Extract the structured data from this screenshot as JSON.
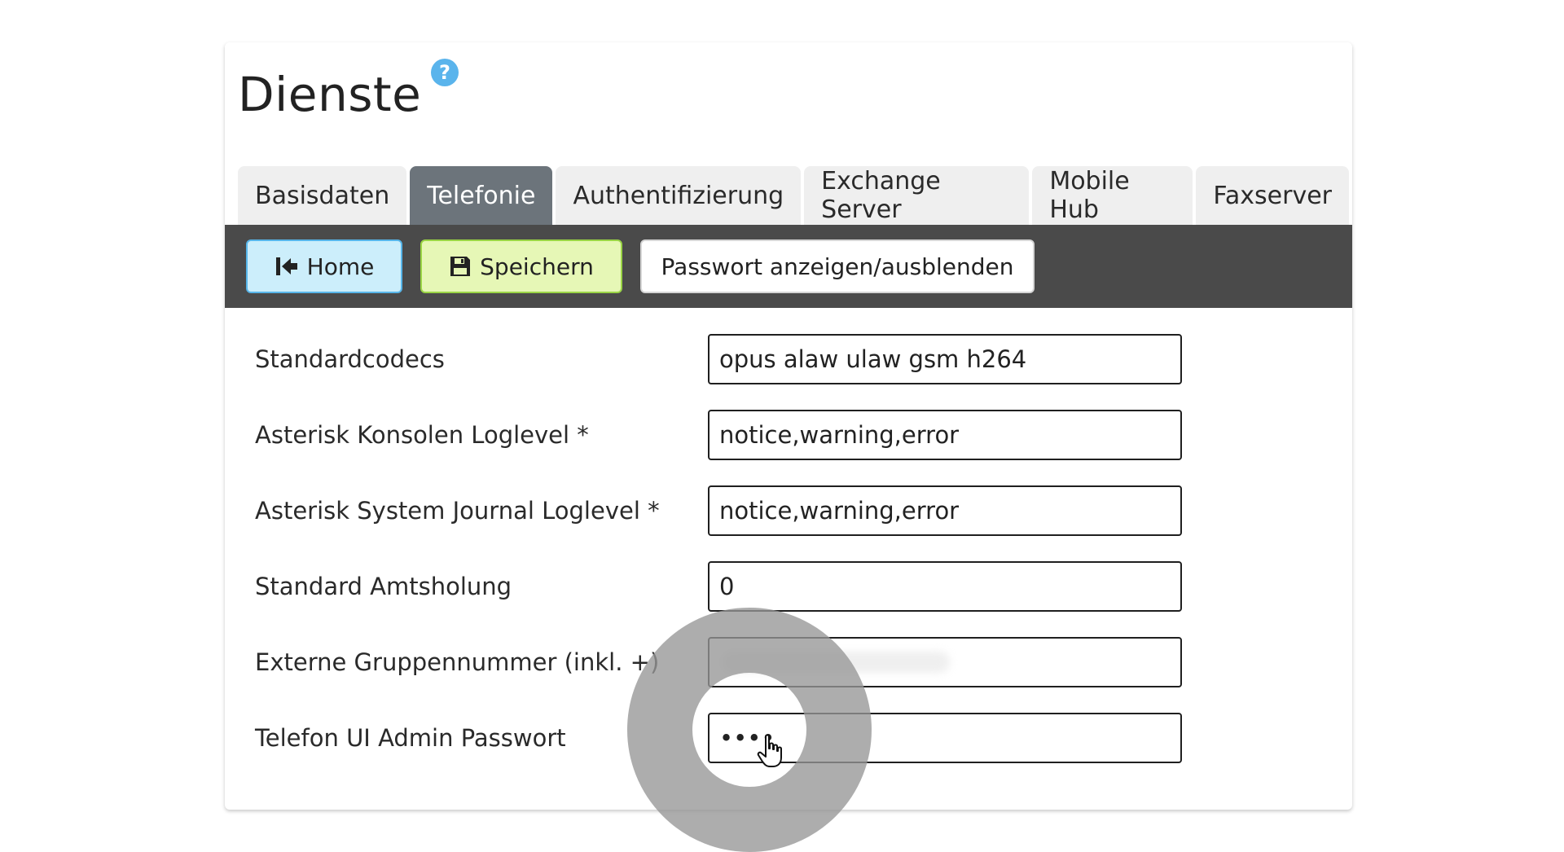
{
  "page": {
    "title": "Dienste",
    "help_icon": "question-circle-icon"
  },
  "tabs": [
    {
      "label": "Basisdaten",
      "active": false
    },
    {
      "label": "Telefonie",
      "active": true
    },
    {
      "label": "Authentifizierung",
      "active": false
    },
    {
      "label": "Exchange Server",
      "active": false
    },
    {
      "label": "Mobile Hub",
      "active": false
    },
    {
      "label": "Faxserver",
      "active": false
    }
  ],
  "toolbar": {
    "home_label": "Home",
    "home_icon": "first-page-icon",
    "save_label": "Speichern",
    "save_icon": "floppy-disk-icon",
    "toggle_password_label": "Passwort anzeigen/ausblenden"
  },
  "form": {
    "fields": [
      {
        "label": "Standardcodecs",
        "value": "opus alaw ulaw gsm h264"
      },
      {
        "label": "Asterisk Konsolen Loglevel *",
        "value": "notice,warning,error"
      },
      {
        "label": "Asterisk System Journal Loglevel *",
        "value": "notice,warning,error"
      },
      {
        "label": "Standard Amtsholung",
        "value": "0"
      },
      {
        "label": "Externe Gruppennummer (inkl. +)",
        "value": ""
      },
      {
        "label": "Telefon UI Admin Passwort",
        "value": "1234"
      }
    ]
  },
  "colors": {
    "tab_active": "#6c747b",
    "toolbar_bg": "#4a4a4a",
    "home_button_bg": "#cceefb",
    "save_button_bg": "#e6f7b6",
    "help_icon": "#5ab4ec"
  }
}
